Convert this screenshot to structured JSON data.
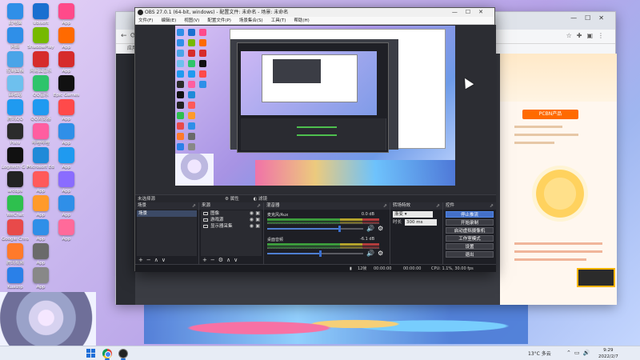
{
  "desktop": {
    "icons": [
      {
        "label": "此电脑",
        "color": "#2f8fe8"
      },
      {
        "label": "网络",
        "color": "#2f8fe8"
      },
      {
        "label": "控制面板",
        "color": "#4aa4e8"
      },
      {
        "label": "回收站",
        "color": "#6ec0ee"
      },
      {
        "label": "腾讯QQ",
        "color": "#1f9af0"
      },
      {
        "label": "Pixiv",
        "color": "#2b2b2b"
      },
      {
        "label": "Logitech G HUB",
        "color": "#111"
      },
      {
        "label": "arcdps",
        "color": "#222"
      },
      {
        "label": "WeChat",
        "color": "#2ec04e"
      },
      {
        "label": "Google Chrome",
        "color": "#e84a4a"
      },
      {
        "label": "腾讯视频",
        "color": "#ff7a2b"
      },
      {
        "label": "Kuaizip",
        "color": "#2a80e8"
      },
      {
        "label": "Ubisoft",
        "color": "#1a6fd0"
      },
      {
        "label": "ShadowPlay",
        "color": "#76b900"
      },
      {
        "label": "网易云音乐",
        "color": "#d62b2b"
      },
      {
        "label": "QQ音乐",
        "color": "#2ec46b"
      },
      {
        "label": "QQ浏览器",
        "color": "#1f9af0"
      },
      {
        "label": "哔哩哔哩",
        "color": "#ff5ea0"
      },
      {
        "label": "Microsoft Edge",
        "color": "#1f8ad8"
      },
      {
        "label": "App",
        "color": "#ff5a5a"
      },
      {
        "label": "App",
        "color": "#ff9a2b"
      },
      {
        "label": "App",
        "color": "#2f8fe8"
      },
      {
        "label": "App",
        "color": "#6a6a6a"
      },
      {
        "label": "App",
        "color": "#888"
      },
      {
        "label": "App",
        "color": "#ff4a8a"
      },
      {
        "label": "App",
        "color": "#ff6a00"
      },
      {
        "label": "App",
        "color": "#d62b2b"
      },
      {
        "label": "Epic Games",
        "color": "#111"
      },
      {
        "label": "App",
        "color": "#ff4a4a"
      },
      {
        "label": "App",
        "color": "#2f8fe8"
      },
      {
        "label": "App",
        "color": "#1f9af0"
      },
      {
        "label": "App",
        "color": "#8a6cff"
      },
      {
        "label": "App",
        "color": "#2f8fe8"
      },
      {
        "label": "App",
        "color": "#ff6a9a"
      }
    ]
  },
  "browser": {
    "bookmark_label": "应用",
    "badge": "PCBN产品"
  },
  "obs": {
    "title": "OBS 27.0.1 (64-bit, windows) - 配置文件: 未命名 - 场景: 未命名",
    "menu": [
      "文件(F)",
      "编辑(E)",
      "视图(V)",
      "配置文件(P)",
      "场景集合(S)",
      "工具(T)",
      "帮助(H)"
    ],
    "scene_tab": {
      "left": "未选择源",
      "props": "属性",
      "filters": "滤镜"
    },
    "scenes": {
      "header": "场景",
      "items": [
        "场景"
      ]
    },
    "sources": {
      "header": "来源",
      "items": [
        "图像",
        "游戏源",
        "显示器采集"
      ]
    },
    "mixer": {
      "header": "混音器",
      "tracks": [
        {
          "name": "麦克风/Aux",
          "db": "0.0 dB",
          "level": 0.75
        },
        {
          "name": "桌面音频",
          "db": "-6.1 dB",
          "level": 0.55
        }
      ]
    },
    "transitions": {
      "header": "转场特效",
      "type": "渐变",
      "duration_label": "时长",
      "duration_value": "300 ms"
    },
    "controls": {
      "header": "控件",
      "buttons": [
        {
          "label": "停止推流",
          "active": true
        },
        {
          "label": "开始录制",
          "active": false
        },
        {
          "label": "启动虚拟摄像机",
          "active": false
        },
        {
          "label": "工作室模式",
          "active": false
        },
        {
          "label": "设置",
          "active": false
        },
        {
          "label": "退出",
          "active": false
        }
      ]
    },
    "status": {
      "dropped": "12帧",
      "live": "00:00:00",
      "rec": "00:00:00",
      "cpu": "CPU: 1.1%, 30.00 fps"
    }
  },
  "taskbar": {
    "weather": "13°C 多云",
    "time": "9:29",
    "date": "2022/2/7"
  }
}
